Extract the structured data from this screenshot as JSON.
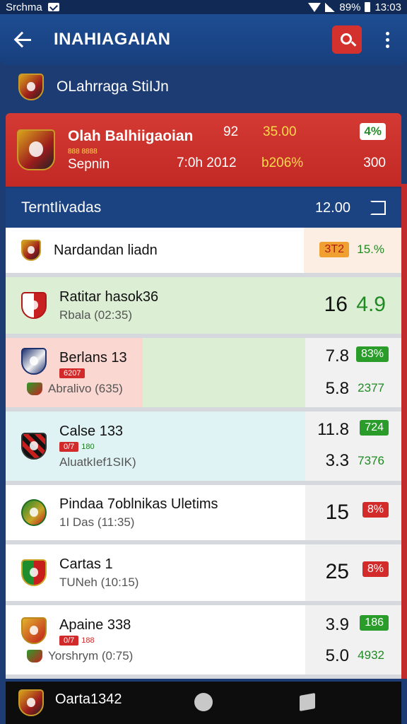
{
  "status_bar": {
    "carrier": "Srchma",
    "battery": "89%",
    "time": "13:03"
  },
  "app_bar": {
    "title": "INAHIAGAIAN"
  },
  "league": {
    "title": "OLahrraga StiIJn"
  },
  "featured": {
    "name": "Olah Balhiigaoian",
    "code": "888 8888",
    "sub": "Sepnin",
    "v1": "92",
    "v2": "35.00",
    "v3": "4%",
    "v4": "7:0h 2012",
    "v5": "b206%",
    "v6": "300"
  },
  "section": {
    "label": "TerntIivadas",
    "value": "12.00"
  },
  "rows": [
    {
      "name": "Nardandan liadn",
      "badge": "3T2",
      "pct": "15.%"
    },
    {
      "name": "Ratitar hasok36",
      "sub": "Rbala (02:35)",
      "odd": "16",
      "val": "4.9"
    },
    {
      "name": "Berlans 13",
      "tag": "6207",
      "sub": "Abralivo (635)",
      "odd1": "7.8",
      "pill": "83%",
      "odd2": "5.8",
      "val2": "2377"
    },
    {
      "name": "Calse 133",
      "tag": "0/7",
      "tag2": "180",
      "sub": "AluatkIef1SIK)",
      "odd1": "11.8",
      "pill": "724",
      "odd2": "3.3",
      "val2": "7376"
    },
    {
      "name": "Pindaa 7oblnikas Uletims",
      "sub": "1I Das (11:35)",
      "odd": "15",
      "pill": "8%"
    },
    {
      "name": "Cartas 1",
      "sub": "TUNeh (10:15)",
      "odd": "25",
      "pill": "8%"
    },
    {
      "name": "Apaine 338",
      "tag": "0/7",
      "tag2": "188",
      "sub": "Yorshrym (0:75)",
      "odd1": "3.9",
      "pill": "186",
      "odd2": "5.0",
      "val2": "4932"
    }
  ],
  "bottom": {
    "name": "Oarta1342"
  }
}
